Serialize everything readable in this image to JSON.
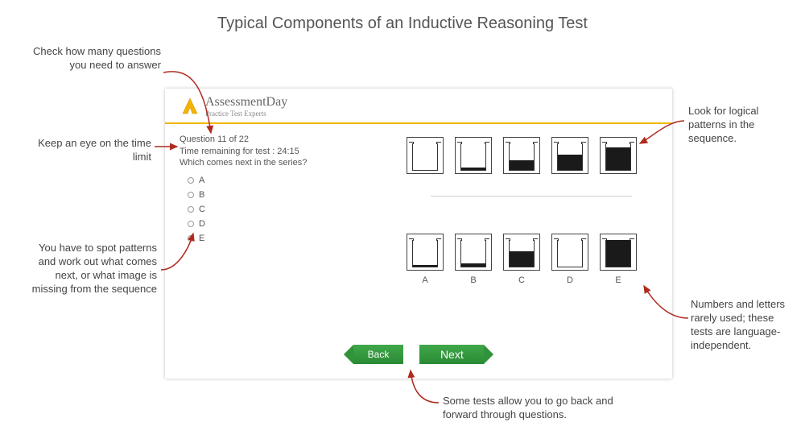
{
  "title": "Typical Components of an Inductive Reasoning Test",
  "annotations": {
    "a1": "Check how many questions you need to answer",
    "a2": "Keep an eye on the time limit",
    "a3": "You have to spot patterns and work out what comes next, or what image is missing from the sequence",
    "a4": "Look for logical patterns in the sequence.",
    "a5": "Numbers and letters rarely used; these tests are language-independent.",
    "a6": "Some tests allow you to go back and forward through questions."
  },
  "brand": {
    "name": "AssessmentDay",
    "sub": "Practice Test Experts"
  },
  "meta": {
    "question_counter": "Question 11 of 22",
    "timer": "Time remaining for test : 24:15"
  },
  "prompt": "Which comes next in the series?",
  "options": [
    "A",
    "B",
    "C",
    "D",
    "E"
  ],
  "sequence_fill_top": [
    0,
    0.08,
    0.35,
    0.55,
    0.82
  ],
  "answer_fill_bottom": [
    0.05,
    0.12,
    0.55,
    0.0,
    1.0
  ],
  "answer_labels": [
    "A",
    "B",
    "C",
    "D",
    "E"
  ],
  "nav": {
    "back": "Back",
    "next": "Next"
  },
  "colors": {
    "brand_yellow": "#f2b600",
    "button_green": "#2f9339",
    "arrow_red": "#b02a1f"
  }
}
